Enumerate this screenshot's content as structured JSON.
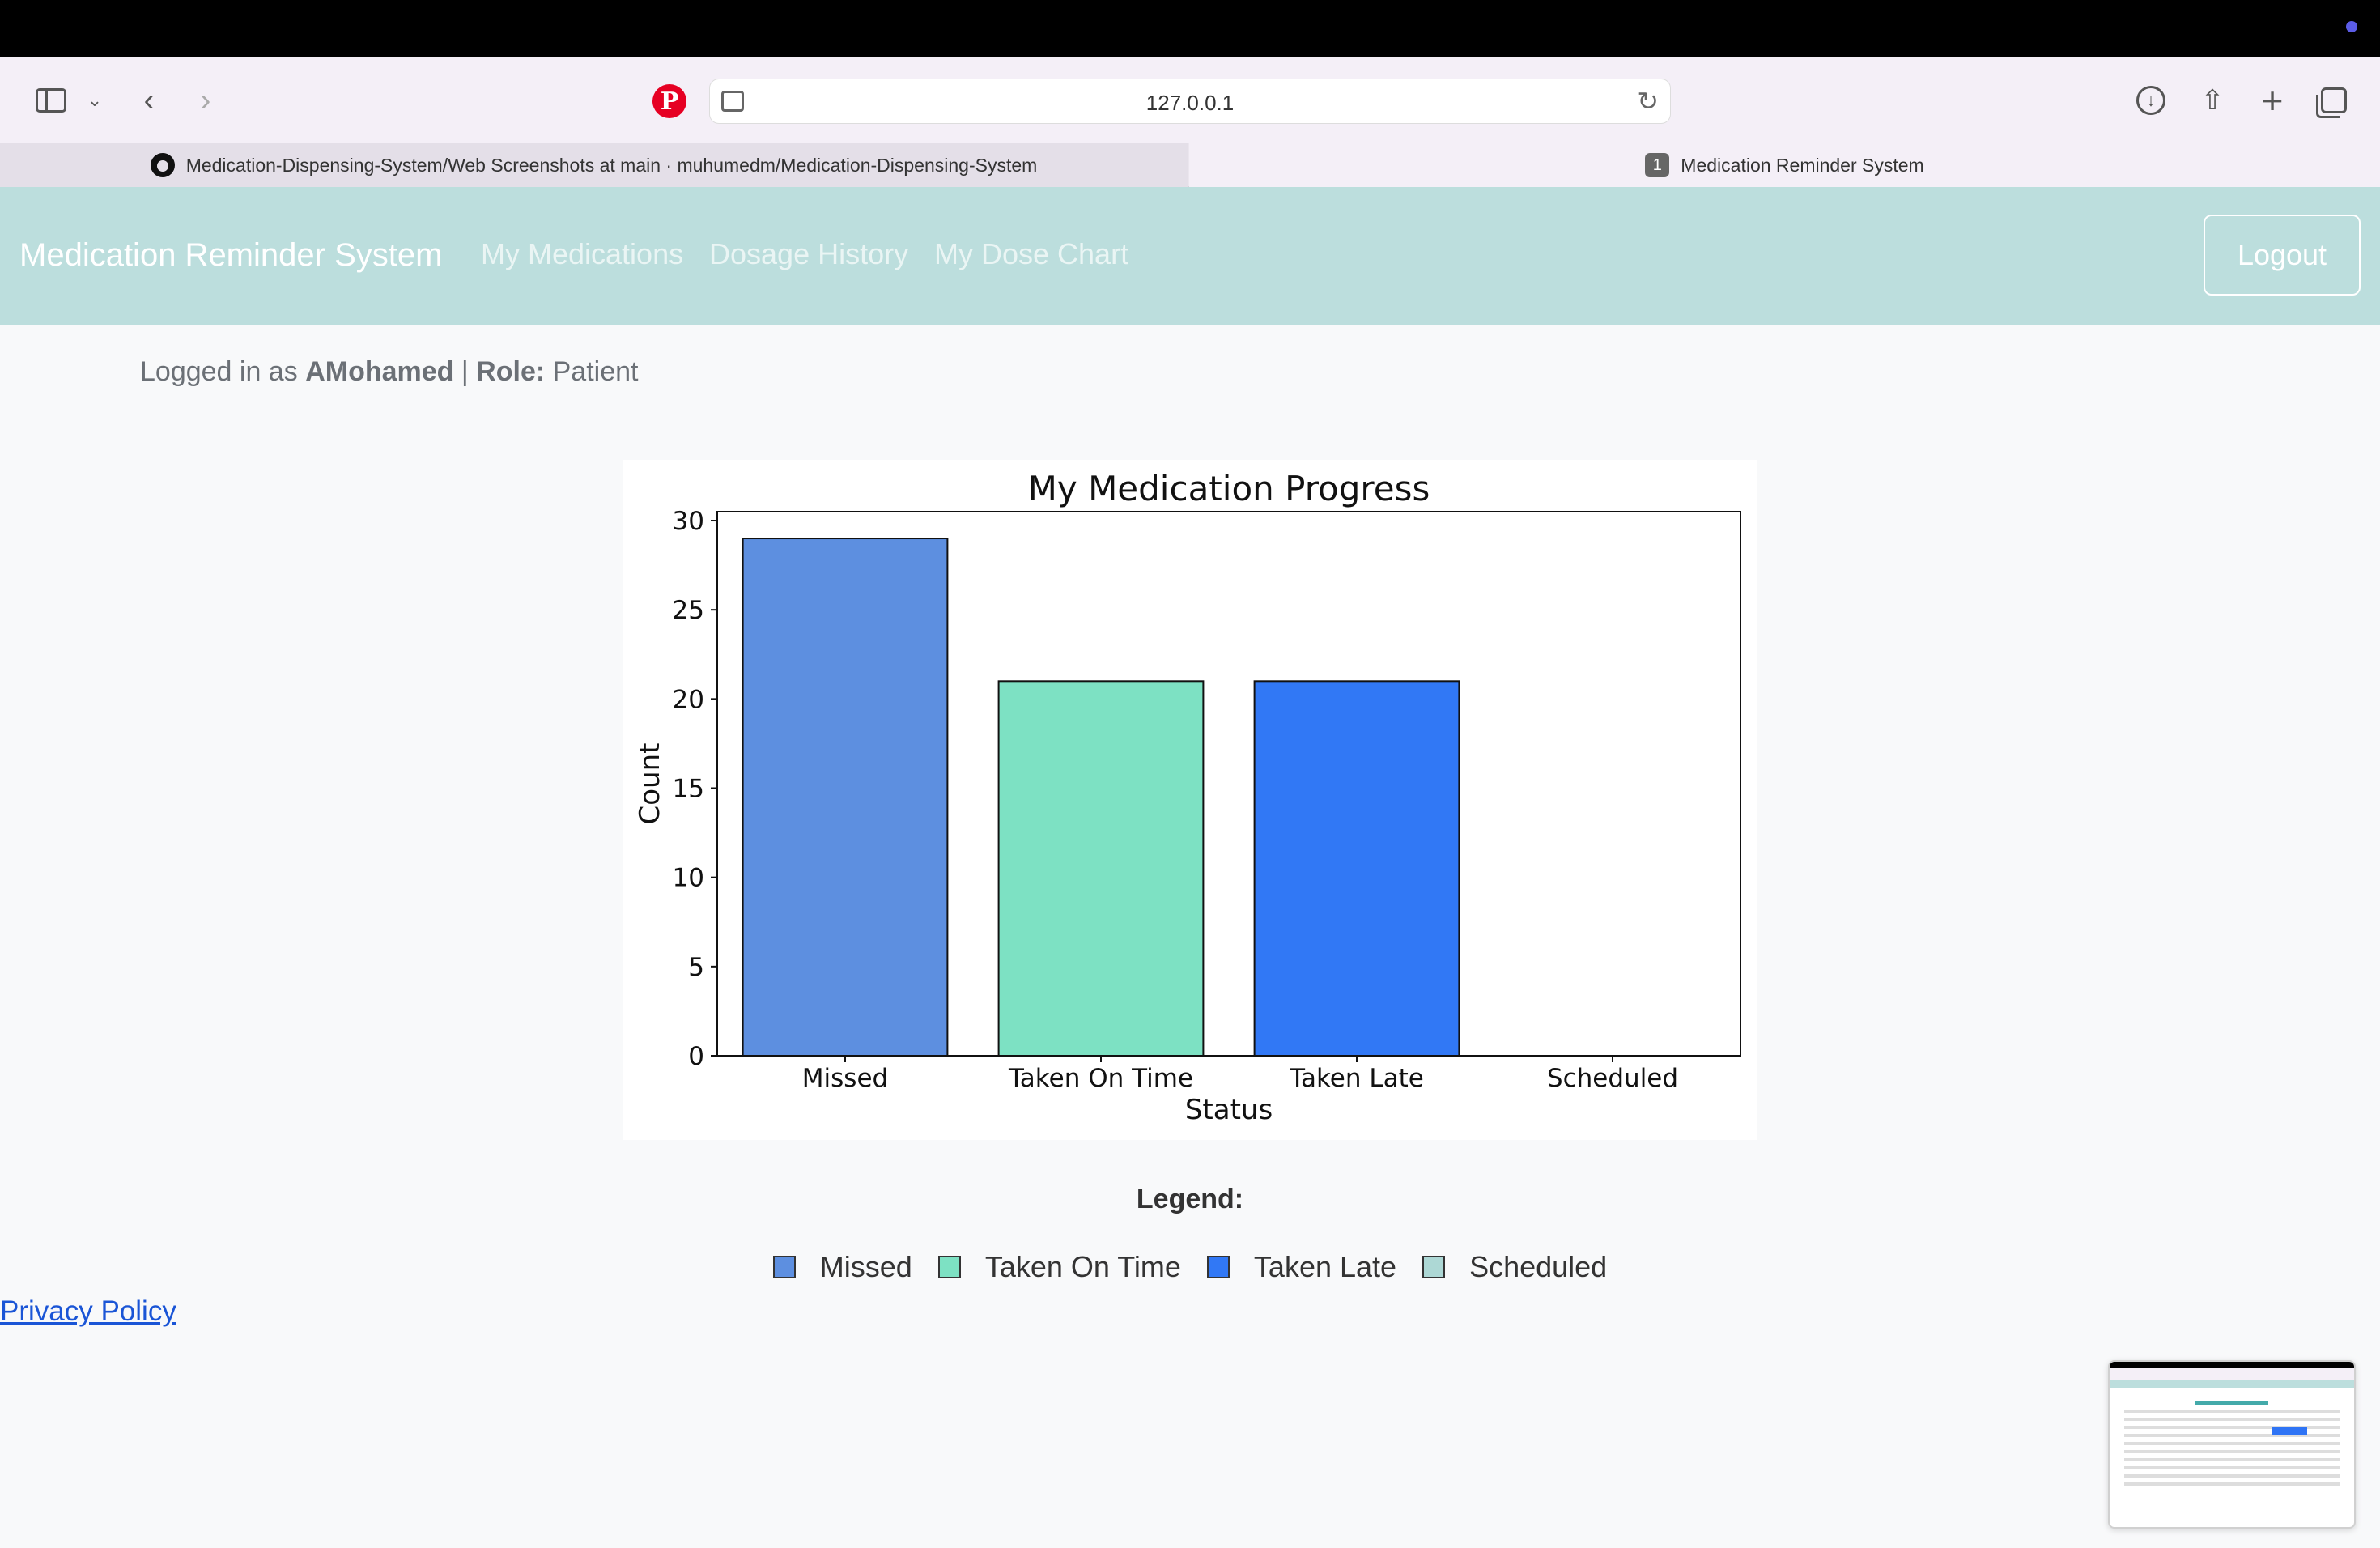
{
  "browser": {
    "url": "127.0.0.1",
    "tabs": [
      {
        "title": "Medication-Dispensing-System/Web Screenshots at main · muhumedm/Medication-Dispensing-System",
        "icon": "github-icon"
      },
      {
        "title": "Medication Reminder System",
        "badge": "1"
      }
    ]
  },
  "navbar": {
    "brand": "Medication Reminder System",
    "links": [
      "My Medications",
      "Dosage History",
      "My Dose Chart"
    ],
    "logout": "Logout"
  },
  "user": {
    "prefix": "Logged in as",
    "username": "AMohamed",
    "separator": "|",
    "role_label": "Role:",
    "role": "Patient"
  },
  "chart_data": {
    "type": "bar",
    "title": "My Medication Progress",
    "xlabel": "Status",
    "ylabel": "Count",
    "categories": [
      "Missed",
      "Taken On Time",
      "Taken Late",
      "Scheduled"
    ],
    "values": [
      29,
      21,
      21,
      0
    ],
    "colors": [
      "#5d8fe0",
      "#7de1c3",
      "#3178f5",
      "#add8d5"
    ],
    "ylim": [
      0,
      30.5
    ],
    "yticks": [
      0,
      5,
      10,
      15,
      20,
      25,
      30
    ],
    "grid": false
  },
  "legend": {
    "title": "Legend:",
    "items": [
      {
        "label": "Missed",
        "color": "#5d8fe0"
      },
      {
        "label": "Taken On Time",
        "color": "#7de1c3"
      },
      {
        "label": "Taken Late",
        "color": "#3178f5"
      },
      {
        "label": "Scheduled",
        "color": "#add8d5"
      }
    ]
  },
  "footer": {
    "privacy": "Privacy Policy"
  }
}
